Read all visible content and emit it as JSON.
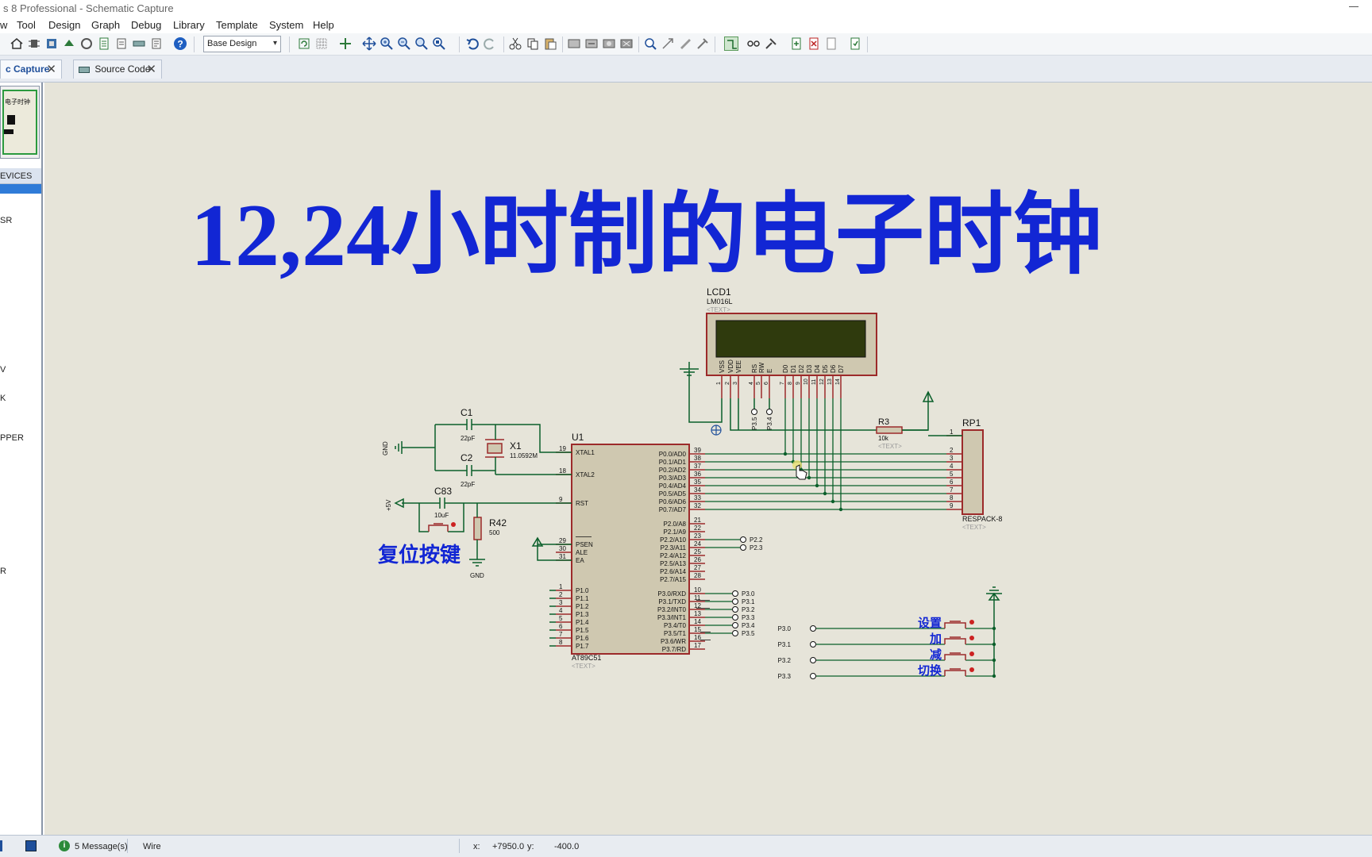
{
  "window": {
    "title": "s 8 Professional - Schematic Capture"
  },
  "menu": [
    "w",
    "Tool",
    "Design",
    "Graph",
    "Debug",
    "Library",
    "Template",
    "System",
    "Help"
  ],
  "toolbar": {
    "layer_select": "Base Design"
  },
  "tabs": [
    {
      "label": "c Capture",
      "active": true
    },
    {
      "label": "Source Code",
      "active": false
    }
  ],
  "overview": {
    "thumb_label": "电子时钟"
  },
  "devices": {
    "header": "EVICES",
    "items": [
      "SR",
      "V",
      "K",
      "PPER",
      "R"
    ]
  },
  "schematic": {
    "headline": "12,24小时制的电子时钟",
    "reset_caption": "复位按键",
    "gnd_label": "GND",
    "vcc_label": "+5V",
    "text_placeholder": "<TEXT>",
    "lcd": {
      "ref": "LCD1",
      "part": "LM016L",
      "pins": [
        "VSS",
        "VDD",
        "VEE",
        "RS",
        "RW",
        "E",
        "D0",
        "D1",
        "D2",
        "D3",
        "D4",
        "D5",
        "D6",
        "D7"
      ],
      "pin_numbers": [
        "1",
        "2",
        "3",
        "4",
        "5",
        "6",
        "7",
        "8",
        "9",
        "10",
        "11",
        "12",
        "13",
        "14"
      ],
      "rs_net": "P3.5",
      "e_net": "P3.4"
    },
    "mcu": {
      "ref": "U1",
      "part": "AT89C51",
      "left_pins": [
        {
          "num": "19",
          "name": "XTAL1"
        },
        {
          "num": "18",
          "name": "XTAL2"
        },
        {
          "num": "9",
          "name": "RST"
        },
        {
          "num": "29",
          "name": "PSEN"
        },
        {
          "num": "30",
          "name": "ALE"
        },
        {
          "num": "31",
          "name": "EA"
        },
        {
          "num": "1",
          "name": "P1.0"
        },
        {
          "num": "2",
          "name": "P1.1"
        },
        {
          "num": "3",
          "name": "P1.2"
        },
        {
          "num": "4",
          "name": "P1.3"
        },
        {
          "num": "5",
          "name": "P1.4"
        },
        {
          "num": "6",
          "name": "P1.5"
        },
        {
          "num": "7",
          "name": "P1.6"
        },
        {
          "num": "8",
          "name": "P1.7"
        }
      ],
      "p0_pins": [
        {
          "num": "39",
          "name": "P0.0/AD0"
        },
        {
          "num": "38",
          "name": "P0.1/AD1"
        },
        {
          "num": "37",
          "name": "P0.2/AD2"
        },
        {
          "num": "36",
          "name": "P0.3/AD3"
        },
        {
          "num": "35",
          "name": "P0.4/AD4"
        },
        {
          "num": "34",
          "name": "P0.5/AD5"
        },
        {
          "num": "33",
          "name": "P0.6/AD6"
        },
        {
          "num": "32",
          "name": "P0.7/AD7"
        }
      ],
      "p2_pins": [
        {
          "num": "21",
          "name": "P2.0/A8"
        },
        {
          "num": "22",
          "name": "P2.1/A9"
        },
        {
          "num": "23",
          "name": "P2.2/A10",
          "net": "P2.2"
        },
        {
          "num": "24",
          "name": "P2.3/A11",
          "net": "P2.3"
        },
        {
          "num": "25",
          "name": "P2.4/A12"
        },
        {
          "num": "26",
          "name": "P2.5/A13"
        },
        {
          "num": "27",
          "name": "P2.6/A14"
        },
        {
          "num": "28",
          "name": "P2.7/A15"
        }
      ],
      "p3_pins": [
        {
          "num": "10",
          "name": "P3.0/RXD",
          "net": "P3.0"
        },
        {
          "num": "11",
          "name": "P3.1/TXD",
          "net": "P3.1"
        },
        {
          "num": "12",
          "name": "P3.2/INT0",
          "net": "P3.2"
        },
        {
          "num": "13",
          "name": "P3.3/INT1",
          "net": "P3.3"
        },
        {
          "num": "14",
          "name": "P3.4/T0",
          "net": "P3.4"
        },
        {
          "num": "15",
          "name": "P3.5/T1",
          "net": "P3.5"
        },
        {
          "num": "16",
          "name": "P3.6/WR"
        },
        {
          "num": "17",
          "name": "P3.7/RD"
        }
      ]
    },
    "c1": {
      "ref": "C1",
      "value": "22pF"
    },
    "c2": {
      "ref": "C2",
      "value": "22pF"
    },
    "x1": {
      "ref": "X1",
      "value": "11.0592M"
    },
    "c83": {
      "ref": "C83",
      "value": "10uF"
    },
    "r42": {
      "ref": "R42",
      "value": "500"
    },
    "r3": {
      "ref": "R3",
      "value": "10k"
    },
    "rp1": {
      "ref": "RP1",
      "part": "RESPACK-8",
      "pins": [
        "1",
        "2",
        "3",
        "4",
        "5",
        "6",
        "7",
        "8",
        "9"
      ]
    },
    "buttons": [
      {
        "net": "P3.0",
        "caption": "设置"
      },
      {
        "net": "P3.1",
        "caption": "加"
      },
      {
        "net": "P3.2",
        "caption": "减"
      },
      {
        "net": "P3.3",
        "caption": "切换"
      }
    ]
  },
  "status": {
    "messages": "5 Message(s)",
    "mode": "Wire",
    "x_label": "x:",
    "x_value": "+7950.0",
    "y_label": "y:",
    "y_value": "-400.0"
  },
  "colors": {
    "wire": "#0a5f2a",
    "component": "#9c2a2a",
    "headline": "#1226d4",
    "canvas": "#e6e4d9",
    "lcd_screen": "#2f3a0d"
  }
}
